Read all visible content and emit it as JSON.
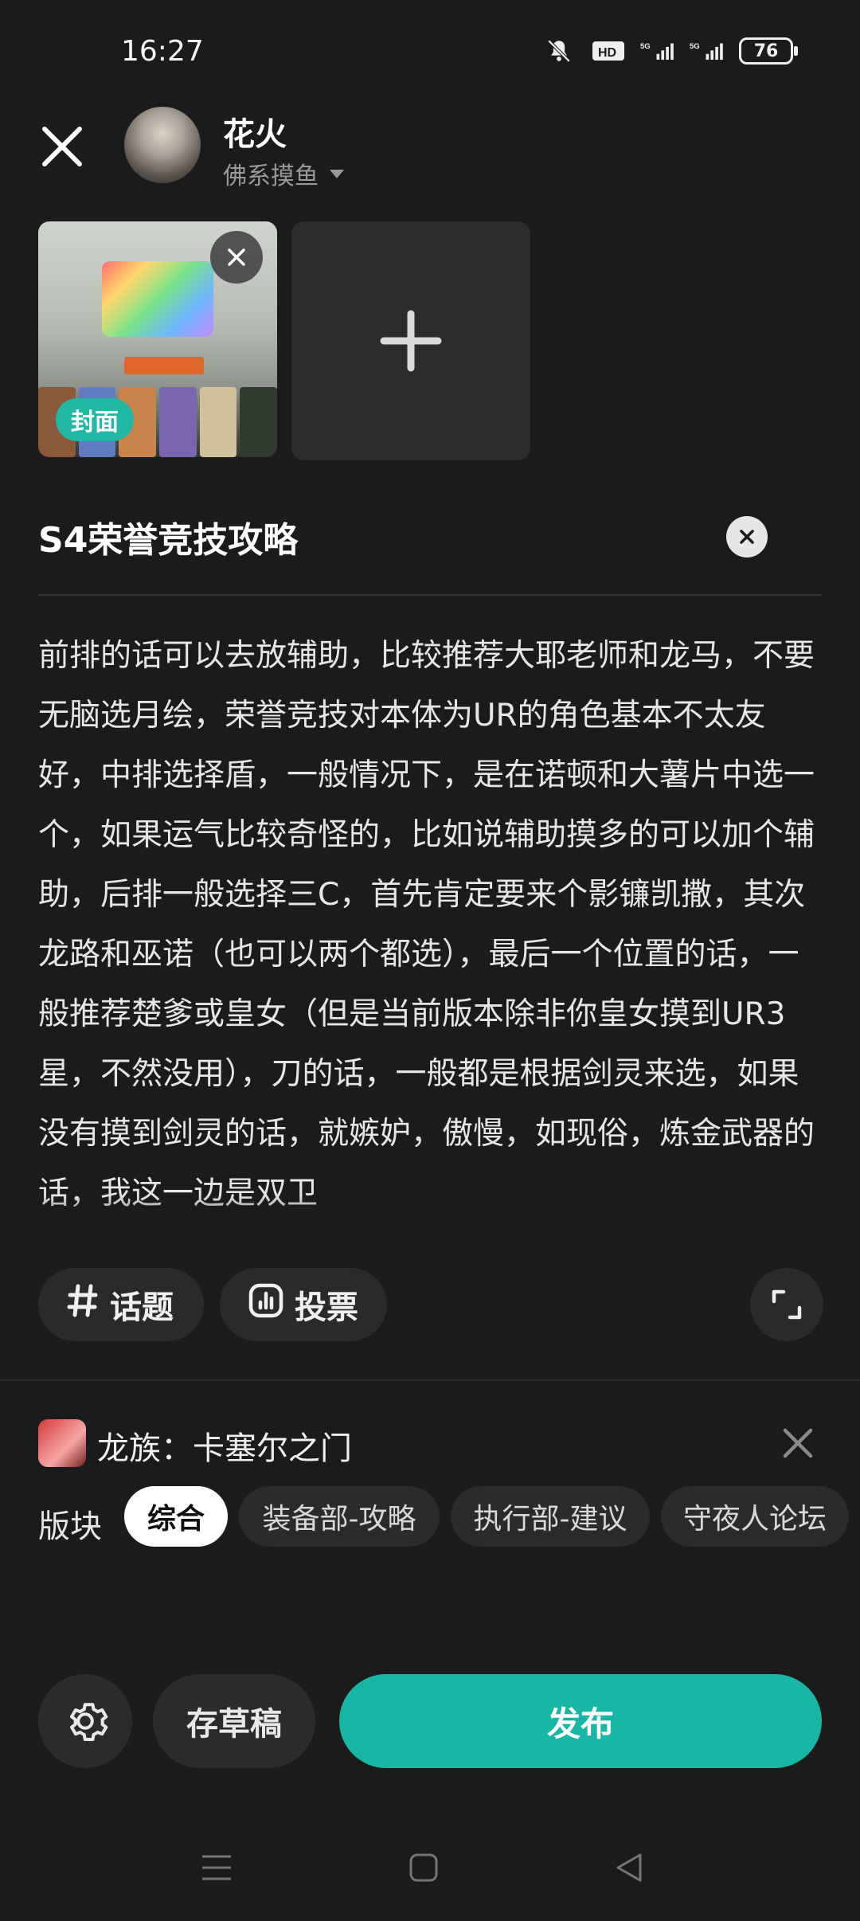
{
  "status_bar": {
    "time": "16:27",
    "battery": "76",
    "icons": [
      "bell-muted-icon",
      "hd-icon",
      "signal-5g-icon",
      "signal-5g-icon"
    ]
  },
  "header": {
    "username": "花火",
    "subtitle": "佛系摸鱼"
  },
  "media": {
    "cover_label": "封面"
  },
  "post": {
    "title": "S4荣誉竞技攻略",
    "body": "前排的话可以去放辅助，比较推荐大耶老师和龙马，不要无脑选月绘，荣誉竞技对本体为UR的角色基本不太友好，中排选择盾，一般情况下，是在诺顿和大薯片中选一个，如果运气比较奇怪的，比如说辅助摸多的可以加个辅助，后排一般选择三C，首先肯定要来个影镰凯撒，其次龙路和巫诺（也可以两个都选），最后一个位置的话，一般推荐楚爹或皇女（但是当前版本除非你皇女摸到UR3星，不然没用），刀的话，一般都是根据剑灵来选，如果没有摸到剑灵的话，就嫉妒，傲慢，如现俗，炼金武器的话，我这一边是双卫"
  },
  "tools": {
    "topic_label": "话题",
    "vote_label": "投票"
  },
  "game": {
    "name": "龙族：卡塞尔之门"
  },
  "boards": {
    "label": "版块",
    "items": [
      "综合",
      "装备部-攻略",
      "执行部-建议",
      "守夜人论坛"
    ],
    "selected": "综合"
  },
  "actions": {
    "draft_label": "存草稿",
    "publish_label": "发布"
  },
  "colors": {
    "accent": "#18b7a5",
    "background": "#1b1b1b"
  }
}
